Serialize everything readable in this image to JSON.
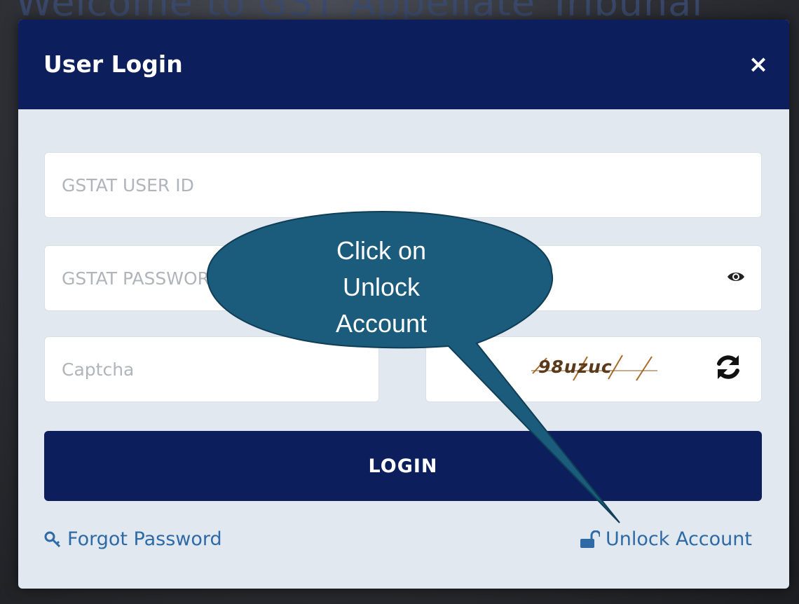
{
  "background": {
    "title": "Welcome to GST Appellate Tribunal"
  },
  "modal": {
    "title": "User Login",
    "close_label": "×"
  },
  "form": {
    "user_id_placeholder": "GSTAT USER ID",
    "password_placeholder": "GSTAT PASSWORD",
    "captcha_placeholder": "Captcha",
    "captcha_value": "98uzuc",
    "login_label": "LOGIN"
  },
  "links": {
    "forgot_password": "Forgot Password",
    "unlock_account": "Unlock Account"
  },
  "callout": {
    "text": "Click on Unlock Account",
    "color": "#1b5b7c"
  },
  "icons": {
    "close": "close-icon",
    "password_toggle": "eye-icon",
    "refresh_captcha": "refresh-icon",
    "forgot": "key-icon",
    "unlock": "unlock-icon"
  },
  "colors": {
    "header": "#0c1e5c",
    "body": "#e1e8ef",
    "link": "#2d6aa6"
  }
}
